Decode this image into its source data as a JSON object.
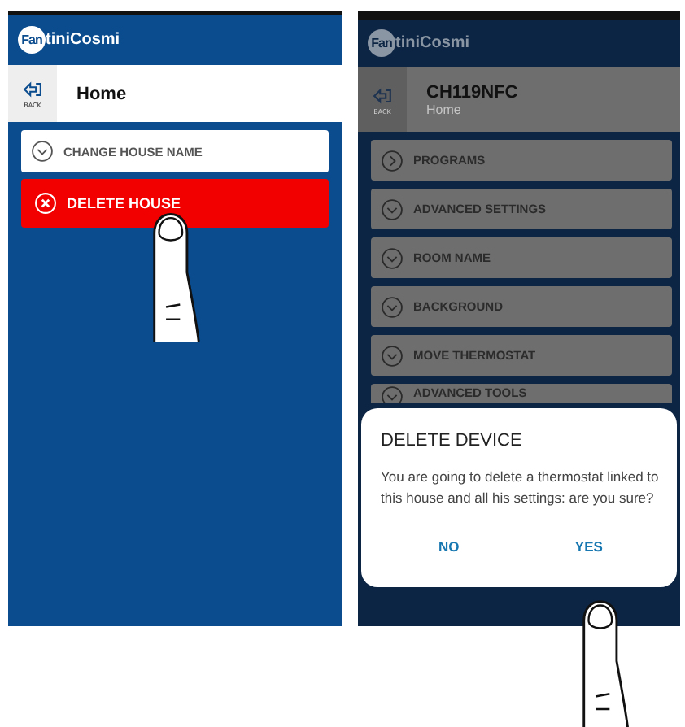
{
  "screens": [
    {
      "dimmed": false,
      "logo": {
        "badge": "Fan",
        "text": "tiniCosmi"
      },
      "header": {
        "back_label": "BACK",
        "title": "Home"
      },
      "menu": [
        {
          "label": "CHANGE HOUSE NAME",
          "kind": "expand"
        },
        {
          "label": "DELETE HOUSE",
          "kind": "danger"
        }
      ]
    },
    {
      "dimmed": true,
      "logo": {
        "badge": "Fan",
        "text": "tiniCosmi"
      },
      "header": {
        "back_label": "BACK",
        "title": "CH119NFC",
        "subtitle": "Home"
      },
      "menu": [
        {
          "label": "PROGRAMS",
          "kind": "open"
        },
        {
          "label": "ADVANCED SETTINGS",
          "kind": "expand"
        },
        {
          "label": "ROOM NAME",
          "kind": "expand"
        },
        {
          "label": "BACKGROUND",
          "kind": "expand"
        },
        {
          "label": "MOVE THERMOSTAT",
          "kind": "expand"
        },
        {
          "label": "ADVANCED TOOLS",
          "kind": "expand"
        }
      ],
      "dialog": {
        "title": "DELETE DEVICE",
        "message": "You are going to delete a thermostat linked to this house and all his settings: are you sure?",
        "buttons": [
          "NO",
          "YES"
        ]
      }
    }
  ]
}
